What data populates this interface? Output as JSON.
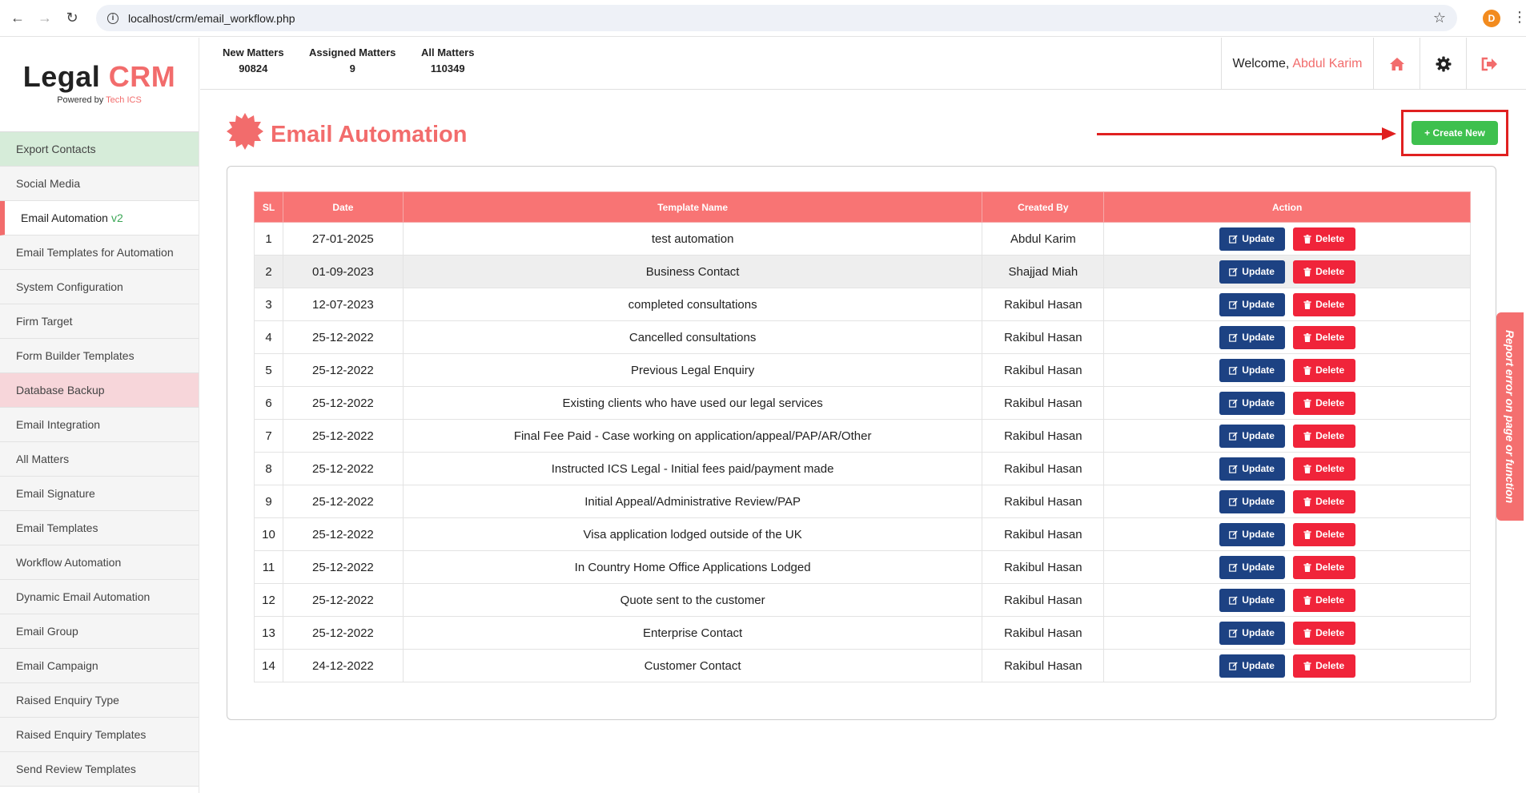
{
  "browser": {
    "url": "localhost/crm/email_workflow.php",
    "profile_initial": "D"
  },
  "brand": {
    "name_main": "Legal",
    "name_accent": "CRM",
    "powered_prefix": "Powered by",
    "powered_by": "Tech ICS"
  },
  "sidebar": {
    "items": [
      {
        "label": "Export Contacts"
      },
      {
        "label": "Social Media"
      },
      {
        "label": "Email Automation",
        "badge": "v2"
      },
      {
        "label": "Email Templates for Automation"
      },
      {
        "label": "System Configuration"
      },
      {
        "label": "Firm Target"
      },
      {
        "label": "Form Builder Templates"
      },
      {
        "label": "Database Backup"
      },
      {
        "label": "Email Integration"
      },
      {
        "label": "All Matters"
      },
      {
        "label": "Email Signature"
      },
      {
        "label": "Email Templates"
      },
      {
        "label": "Workflow Automation"
      },
      {
        "label": "Dynamic Email Automation"
      },
      {
        "label": "Email Group"
      },
      {
        "label": "Email Campaign"
      },
      {
        "label": "Raised Enquiry Type"
      },
      {
        "label": "Raised Enquiry Templates"
      },
      {
        "label": "Send Review Templates"
      }
    ]
  },
  "stats": {
    "new_matters_label": "New Matters",
    "new_matters_value": "90824",
    "assigned_label": "Assigned Matters",
    "assigned_value": "9",
    "all_label": "All Matters",
    "all_value": "110349"
  },
  "header": {
    "welcome_prefix": "Welcome,",
    "user_name": "Abdul Karim"
  },
  "page": {
    "title": "Email Automation",
    "create_label": "+ Create New",
    "report_label": "Report error on page or function"
  },
  "table": {
    "headers": {
      "sl": "SL",
      "date": "Date",
      "name": "Template Name",
      "created_by": "Created By",
      "action": "Action"
    },
    "update_label": "Update",
    "delete_label": "Delete",
    "rows": [
      {
        "sl": "1",
        "date": "27-01-2025",
        "name": "test automation",
        "created_by": "Abdul Karim"
      },
      {
        "sl": "2",
        "date": "01-09-2023",
        "name": "Business Contact",
        "created_by": "Shajjad Miah"
      },
      {
        "sl": "3",
        "date": "12-07-2023",
        "name": "completed consultations",
        "created_by": "Rakibul Hasan"
      },
      {
        "sl": "4",
        "date": "25-12-2022",
        "name": "Cancelled consultations",
        "created_by": "Rakibul Hasan"
      },
      {
        "sl": "5",
        "date": "25-12-2022",
        "name": "Previous Legal Enquiry",
        "created_by": "Rakibul Hasan"
      },
      {
        "sl": "6",
        "date": "25-12-2022",
        "name": "Existing clients who have used our legal services",
        "created_by": "Rakibul Hasan"
      },
      {
        "sl": "7",
        "date": "25-12-2022",
        "name": "Final Fee Paid - Case working on application/appeal/PAP/AR/Other",
        "created_by": "Rakibul Hasan"
      },
      {
        "sl": "8",
        "date": "25-12-2022",
        "name": "Instructed ICS Legal - Initial fees paid/payment made",
        "created_by": "Rakibul Hasan"
      },
      {
        "sl": "9",
        "date": "25-12-2022",
        "name": "Initial Appeal/Administrative Review/PAP",
        "created_by": "Rakibul Hasan"
      },
      {
        "sl": "10",
        "date": "25-12-2022",
        "name": "Visa application lodged outside of the UK",
        "created_by": "Rakibul Hasan"
      },
      {
        "sl": "11",
        "date": "25-12-2022",
        "name": "In Country Home Office Applications Lodged",
        "created_by": "Rakibul Hasan"
      },
      {
        "sl": "12",
        "date": "25-12-2022",
        "name": "Quote sent to the customer",
        "created_by": "Rakibul Hasan"
      },
      {
        "sl": "13",
        "date": "25-12-2022",
        "name": "Enterprise Contact",
        "created_by": "Rakibul Hasan"
      },
      {
        "sl": "14",
        "date": "24-12-2022",
        "name": "Customer Contact",
        "created_by": "Rakibul Hasan"
      }
    ]
  },
  "colors": {
    "accent": "#f26c6c",
    "create_button": "#3ec04e",
    "update_button": "#1d4283",
    "delete_button": "#f0243a",
    "annotation": "#e02020"
  }
}
